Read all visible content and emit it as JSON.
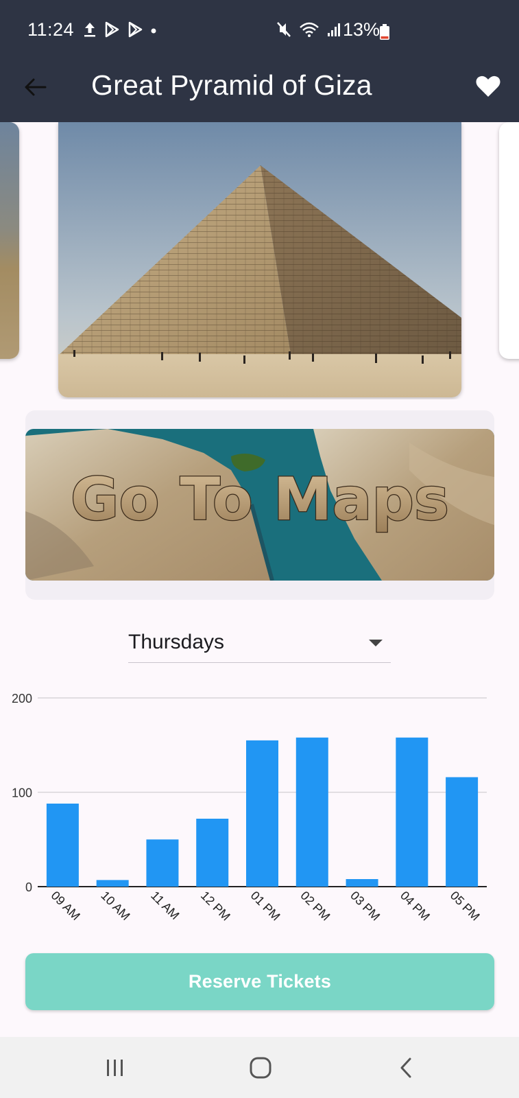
{
  "status_bar": {
    "time": "11:24",
    "battery": "13%"
  },
  "app_bar": {
    "title": "Great Pyramid of Giza"
  },
  "maps": {
    "banner_text": "Go To Maps"
  },
  "day_selector": {
    "selected": "Thursdays"
  },
  "chart_data": {
    "type": "bar",
    "categories": [
      "09 AM",
      "10 AM",
      "11 AM",
      "12 PM",
      "01 PM",
      "02 PM",
      "03 PM",
      "04 PM",
      "05 PM"
    ],
    "values": [
      88,
      7,
      50,
      72,
      155,
      158,
      8,
      158,
      116
    ],
    "yticks": [
      "0",
      "100",
      "200"
    ],
    "ylim": [
      0,
      200
    ],
    "bar_color": "#2196f3",
    "grid": true
  },
  "reserve_button": {
    "label": "Reserve Tickets"
  },
  "colors": {
    "app_bar": "#2e3444",
    "accent": "#7ad6c6",
    "bar": "#2196f3"
  }
}
